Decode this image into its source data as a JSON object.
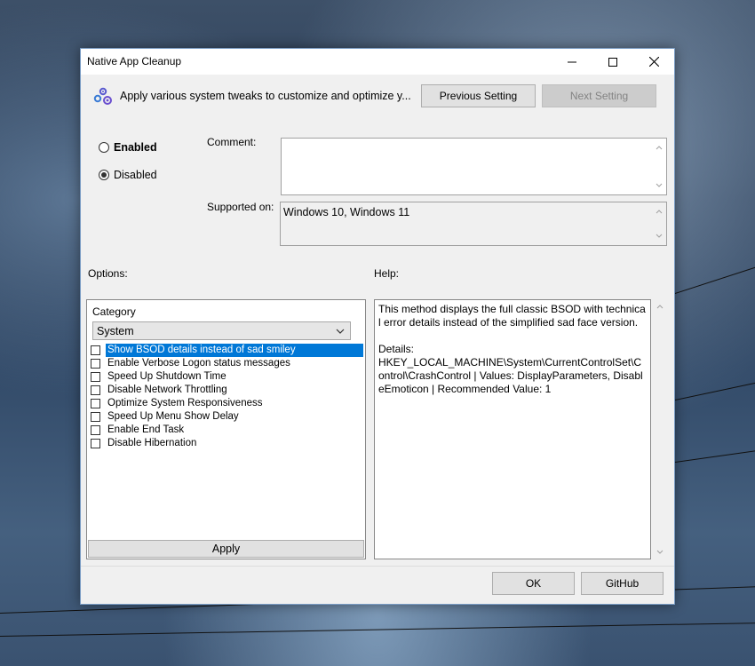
{
  "window": {
    "title": "Native App Cleanup",
    "description": "Apply various system tweaks to customize and optimize y...",
    "prev_button": "Previous Setting",
    "next_button": "Next Setting",
    "next_disabled": true
  },
  "state": {
    "enabled_label": "Enabled",
    "disabled_label": "Disabled",
    "selected": "Disabled"
  },
  "comment": {
    "label": "Comment:",
    "value": ""
  },
  "supported": {
    "label": "Supported on:",
    "value": "Windows 10, Windows 11"
  },
  "options": {
    "label": "Options:",
    "category_label": "Category",
    "category_value": "System",
    "items": [
      {
        "label": "Show BSOD details instead of sad smiley",
        "checked": false,
        "selected": true
      },
      {
        "label": "Enable Verbose Logon status messages",
        "checked": false,
        "selected": false
      },
      {
        "label": "Speed Up Shutdown Time",
        "checked": false,
        "selected": false
      },
      {
        "label": "Disable Network Throttling",
        "checked": false,
        "selected": false
      },
      {
        "label": "Optimize System Responsiveness",
        "checked": false,
        "selected": false
      },
      {
        "label": "Speed Up Menu Show Delay",
        "checked": false,
        "selected": false
      },
      {
        "label": "Enable End Task",
        "checked": false,
        "selected": false
      },
      {
        "label": "Disable Hibernation",
        "checked": false,
        "selected": false
      }
    ],
    "apply_button": "Apply"
  },
  "help": {
    "label": "Help:",
    "text": "This method displays the full classic BSOD with technical error details instead of the simplified sad face version.\n\nDetails:\nHKEY_LOCAL_MACHINE\\System\\CurrentControlSet\\Control\\CrashControl | Values: DisplayParameters, DisableEmoticon | Recommended Value: 1"
  },
  "footer": {
    "ok_button": "OK",
    "github_button": "GitHub"
  },
  "colors": {
    "selection": "#0078d7",
    "window_bg": "#f0f0f0",
    "title_bg": "#ffffff"
  }
}
